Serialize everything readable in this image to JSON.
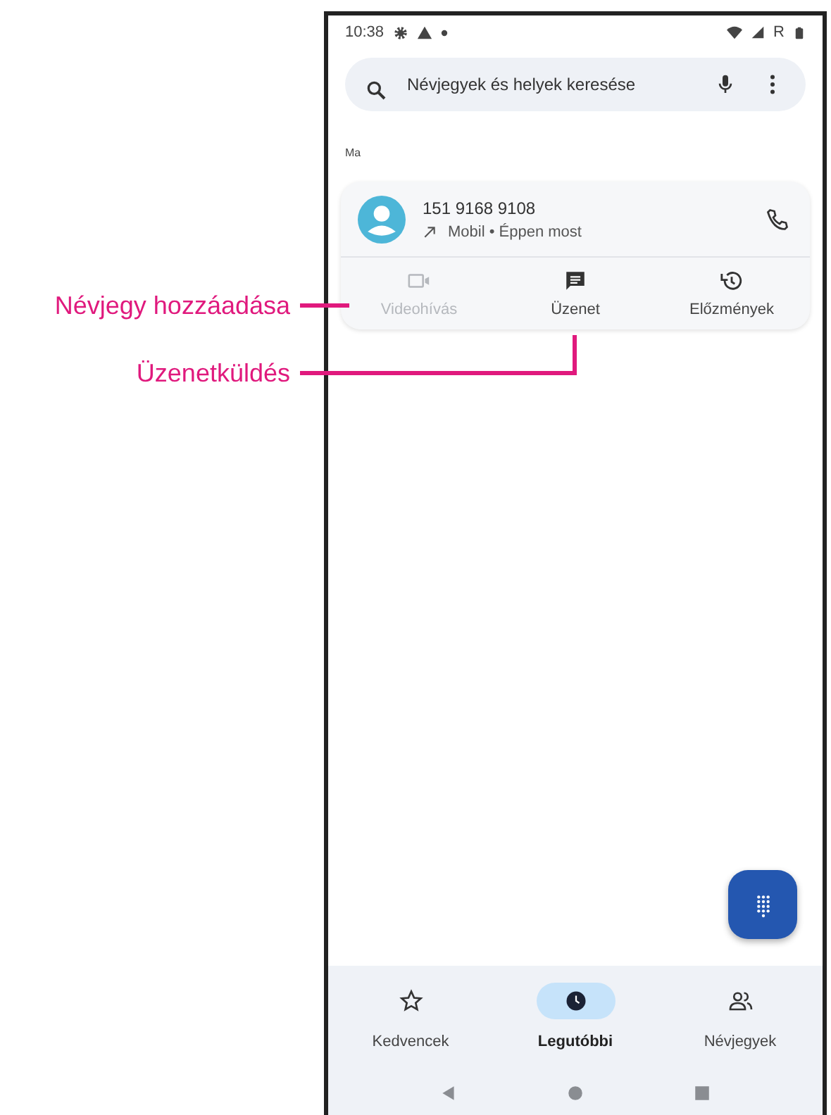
{
  "status_bar": {
    "time": "10:38",
    "network": "R"
  },
  "search": {
    "placeholder": "Névjegyek és helyek keresése"
  },
  "section_label": "Ma",
  "call": {
    "number": "151 9168 9108",
    "detail": "Mobil • Éppen most"
  },
  "actions": [
    {
      "kind": "video",
      "label": "Videohívás",
      "disabled": true
    },
    {
      "kind": "message",
      "label": "Üzenet",
      "disabled": false
    },
    {
      "kind": "history",
      "label": "Előzmények",
      "disabled": false
    }
  ],
  "nav": [
    {
      "kind": "star",
      "label": "Kedvencek",
      "selected": false
    },
    {
      "kind": "clock",
      "label": "Legutóbbi",
      "selected": true
    },
    {
      "kind": "people",
      "label": "Névjegyek",
      "selected": false
    }
  ],
  "callouts": [
    {
      "label": "Névjegy hozzáadása"
    },
    {
      "label": "Üzenetküldés"
    }
  ]
}
